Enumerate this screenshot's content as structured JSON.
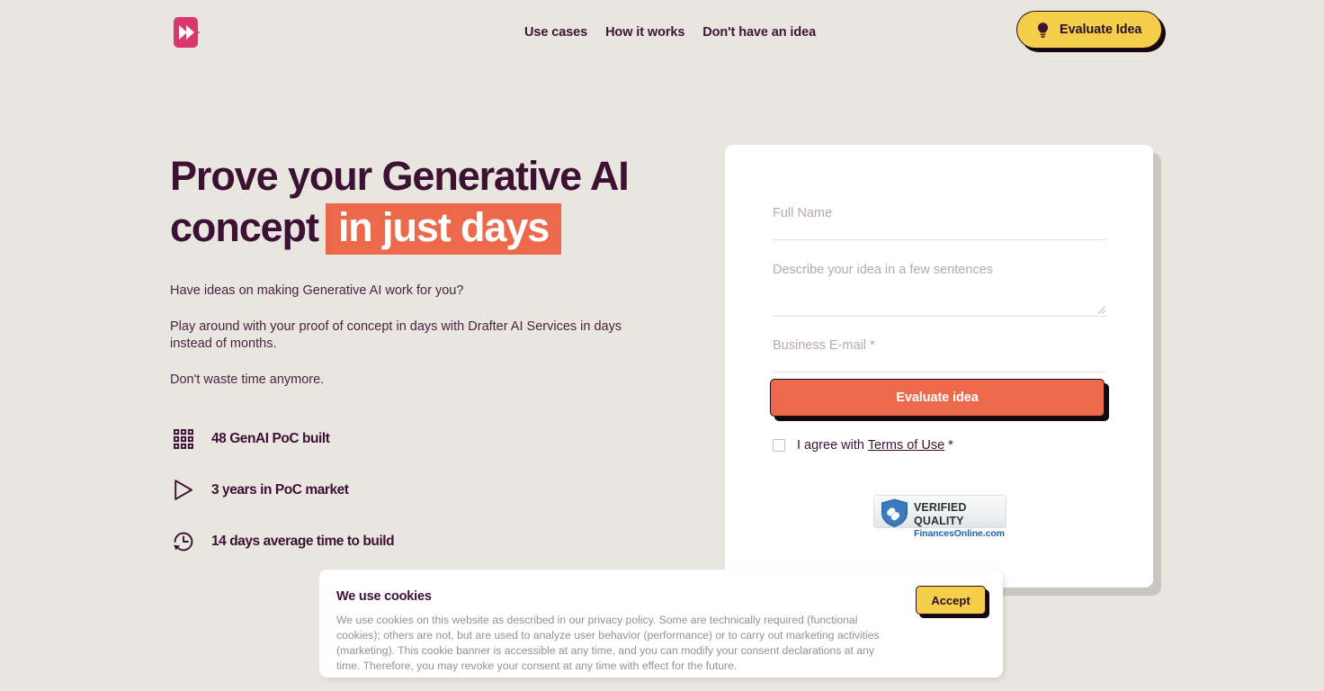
{
  "brand": {
    "logo_icon": "fast-forward-logo-icon",
    "logo_color": "#d9376e"
  },
  "header": {
    "nav": [
      {
        "label": "Use cases"
      },
      {
        "label": "How it works"
      },
      {
        "label": "Don't have an idea"
      }
    ],
    "cta": {
      "label": "Evaluate Idea",
      "icon": "lightbulb-icon",
      "bg_color": "#f5ce4a",
      "text_color": "#2b0f26"
    }
  },
  "hero": {
    "headline_part1": "Prove your Generative AI concept",
    "headline_highlight": "in just days",
    "highlight_color": "#ec6a4b",
    "paragraphs": [
      "Have ideas on making Generative AI work for you?",
      "Play around with your proof of concept in days with Drafter AI Services in days instead of months.",
      "Don't waste time anymore."
    ],
    "stats": [
      {
        "icon": "grid-icon",
        "label": "48 GenAI PoC built"
      },
      {
        "icon": "play-triangle-icon",
        "label": "3 years in PoC market"
      },
      {
        "icon": "clock-history-icon",
        "label": "14 days average time to build"
      }
    ]
  },
  "form": {
    "fields": [
      {
        "name": "full-name",
        "placeholder": "Full Name",
        "value": ""
      },
      {
        "name": "idea",
        "placeholder": "Describe your idea in a few sentences",
        "value": ""
      },
      {
        "name": "business-email",
        "placeholder": "Business E-mail *",
        "value": ""
      }
    ],
    "submit": {
      "label": "Evaluate idea",
      "bg_color": "#ec6a4b",
      "text_color": "#ffffff"
    },
    "agreement": {
      "checked": false,
      "prefix": "I agree with ",
      "link": "Terms of Use",
      "suffix": " *"
    },
    "badge": {
      "icon": "shield-check-icon",
      "line1": "VERIFIED QUALITY",
      "line2": "FinancesOnline.com",
      "accent_color": "#1d63b0"
    }
  },
  "cookie_banner": {
    "title": "We use cookies",
    "body": "We use cookies on this website as described in our privacy policy. Some are technically required (functional cookies); others are not, but are used to analyze user behavior (performance) or to carry out marketing activities (marketing). This cookie banner is accessible at any time, and you can modify your consent declarations at any time. Therefore, you may revoke your consent at any time with effect for the future.",
    "accept_label": "Accept"
  }
}
